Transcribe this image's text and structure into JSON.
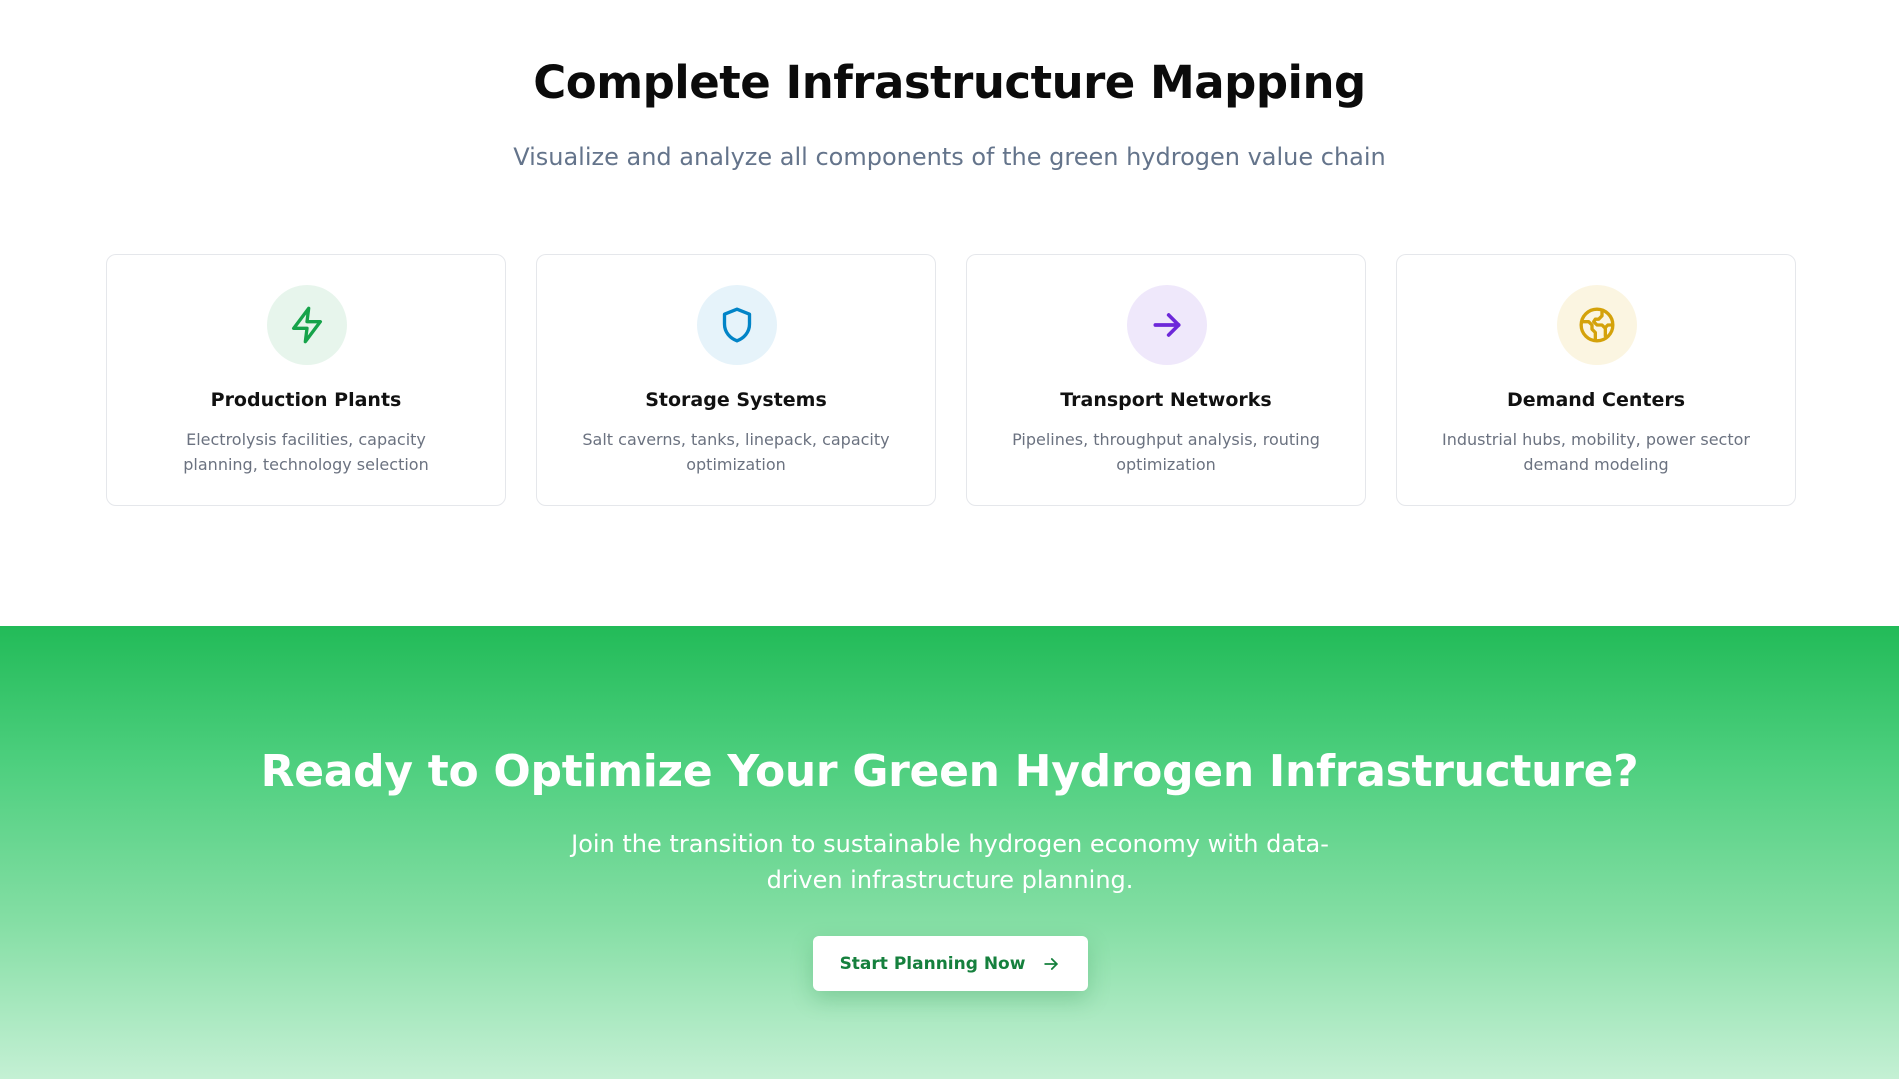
{
  "mapping": {
    "title": "Complete Infrastructure Mapping",
    "subtitle": "Visualize and analyze all components of the green hydrogen value chain",
    "cards": [
      {
        "icon": "lightning-icon",
        "title": "Production Plants",
        "description": "Electrolysis facilities, capacity planning, technology selection",
        "icon_color": "#16a34a",
        "icon_bg": "#e7f5ec"
      },
      {
        "icon": "shield-icon",
        "title": "Storage Systems",
        "description": "Salt caverns, tanks, linepack, capacity optimization",
        "icon_color": "#0284c7",
        "icon_bg": "#e6f3fa"
      },
      {
        "icon": "arrow-right-icon",
        "title": "Transport Networks",
        "description": "Pipelines, throughput analysis, routing optimization",
        "icon_color": "#6d28d9",
        "icon_bg": "#efe8fb"
      },
      {
        "icon": "globe-icon",
        "title": "Demand Centers",
        "description": "Industrial hubs, mobility, power sector demand modeling",
        "icon_color": "#d4a20a",
        "icon_bg": "#fbf5e1"
      }
    ]
  },
  "cta": {
    "title": "Ready to Optimize Your Green Hydrogen Infrastructure?",
    "text": "Join the transition to sustainable hydrogen economy with data-driven infrastructure planning.",
    "button_label": "Start Planning Now",
    "button_icon": "arrow-right-icon",
    "accent_color": "#22c55e",
    "button_text_color": "#15803d"
  }
}
